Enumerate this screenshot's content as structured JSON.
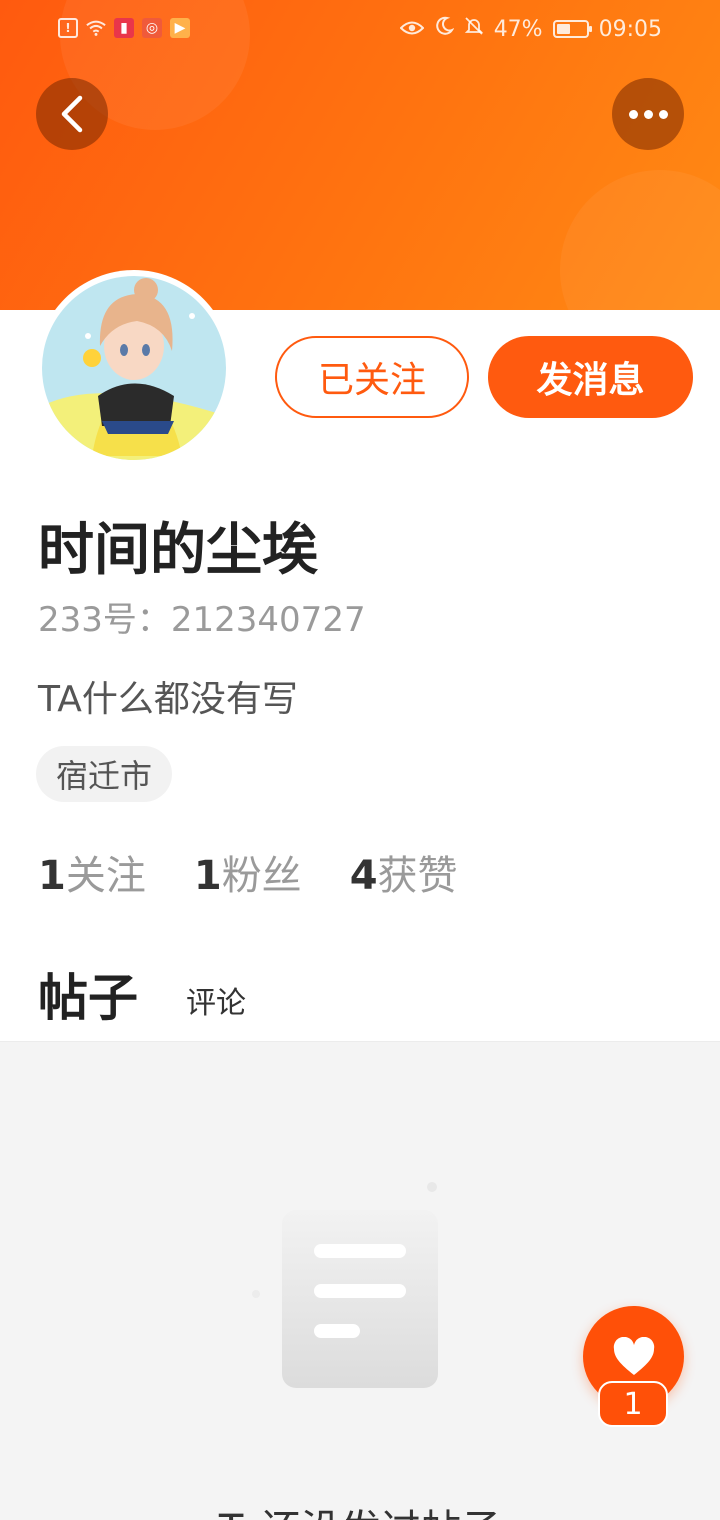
{
  "status_bar": {
    "battery_level": 0.47,
    "battery_percent": "47%",
    "time": "09:05",
    "left_icons": [
      "notification-alert-icon",
      "wifi-icon",
      "book-app-icon",
      "app-icon",
      "play-app-icon"
    ],
    "right_icons": [
      "eye-icon",
      "moon-icon",
      "bell-off-icon"
    ]
  },
  "header": {
    "gradient_start": "#ff5a0f",
    "gradient_end": "#ff8a14"
  },
  "profile": {
    "followed_label": "已关注",
    "message_label": "发消息",
    "name": "时间的尘埃",
    "uid": "233号：212340727",
    "bio": "TA什么都没有写",
    "location": "宿迁市",
    "stats": [
      {
        "num": "1",
        "label": "关注"
      },
      {
        "num": "1",
        "label": "粉丝"
      },
      {
        "num": "4",
        "label": "获赞"
      }
    ]
  },
  "tabs": {
    "posts": "帖子",
    "comments": "评论",
    "active": "posts"
  },
  "empty": {
    "text": "Ta还没发过帖子"
  },
  "like": {
    "count": "1"
  },
  "colors": {
    "accent": "#ff5a0f",
    "fab": "#ff5008"
  }
}
